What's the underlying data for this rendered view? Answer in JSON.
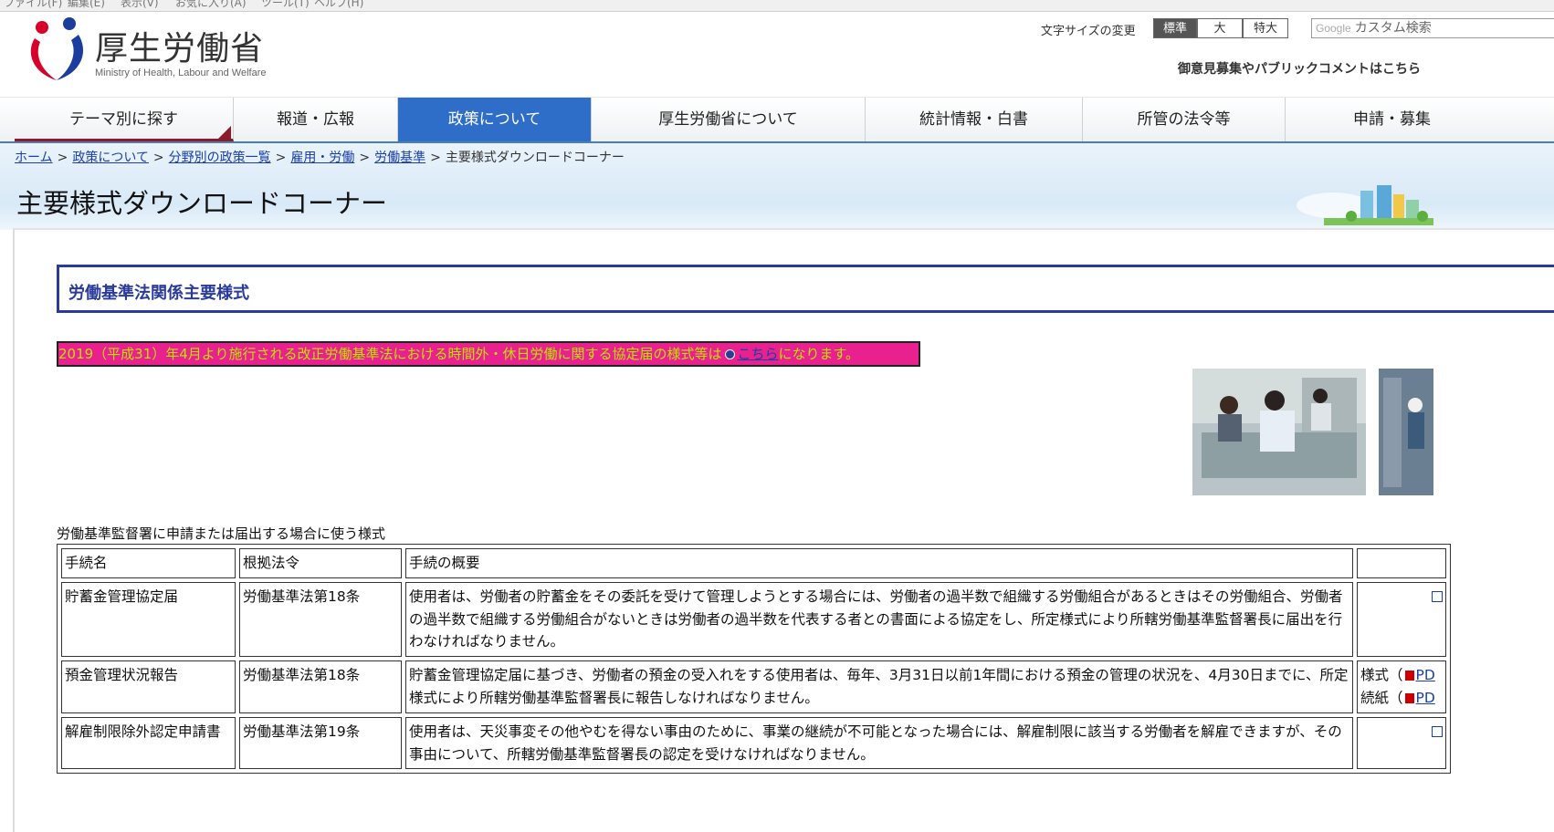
{
  "browser_menu": [
    "ファイル(F)",
    "編集(E)",
    "表示(V)",
    "お気に入り(A)",
    "ツール(T)",
    "ヘルプ(H)"
  ],
  "header": {
    "title": "厚生労働省",
    "subtitle": "Ministry of Health, Labour and Welfare",
    "font_size_label": "文字サイズの変更",
    "font_size_options": [
      "標準",
      "大",
      "特大"
    ],
    "search_brand": "Google",
    "search_placeholder": "カスタム検索",
    "opinion_link": "御意見募集やパブリックコメントはこちら"
  },
  "nav": [
    "テーマ別に探す",
    "報道・広報",
    "政策について",
    "厚生労働省について",
    "統計情報・白書",
    "所管の法令等",
    "申請・募集"
  ],
  "breadcrumb": [
    "ホーム",
    "政策について",
    "分野別の政策一覧",
    "雇用・労働",
    "労働基準",
    "主要様式ダウンロードコーナー"
  ],
  "page_title": "主要様式ダウンロードコーナー",
  "section_title": "労働基準法関係主要様式",
  "notice": {
    "text_before": "2019（平成31）年4月より施行される改正労働基準法における時間外・休日労働に関する協定届の様式等は",
    "link": "こちら",
    "text_after": "になります。"
  },
  "table_caption": "労働基準監督署に申請または届出する場合に使う様式",
  "table": {
    "headers": [
      "手続名",
      "根拠法令",
      "手続の概要",
      ""
    ],
    "rows": [
      {
        "name": "貯蓄金管理協定届",
        "law": "労働基準法第18条",
        "summary": "使用者は、労働者の貯蓄金をその委託を受けて管理しようとする場合には、労働者の過半数で組織する労働組合があるときはその労働組合、労働者の過半数で組織する労働組合がないときは労働者の過半数を代表する者との書面による協定をし、所定様式により所轄労働基準監督署長に届出を行わなければなりません。"
      },
      {
        "name": "預金管理状況報告",
        "law": "労働基準法第18条",
        "summary": "貯蓄金管理協定届に基づき、労働者の預金の受入れをする使用者は、毎年、3月31日以前1年間における預金の管理の状況を、4月30日までに、所定様式により所轄労働基準監督署長に報告しなければなりません。",
        "links": [
          "様式（",
          "PD",
          "続紙（",
          "PD"
        ]
      },
      {
        "name": "解雇制限除外認定申請書",
        "law": "労働基準法第19条",
        "summary": "使用者は、天災事変その他やむを得ない事由のために、事業の継続が不可能となった場合には、解雇制限に該当する労働者を解雇できますが、その事由について、所轄労働基準監督署長の認定を受けなければなりません。"
      }
    ]
  }
}
